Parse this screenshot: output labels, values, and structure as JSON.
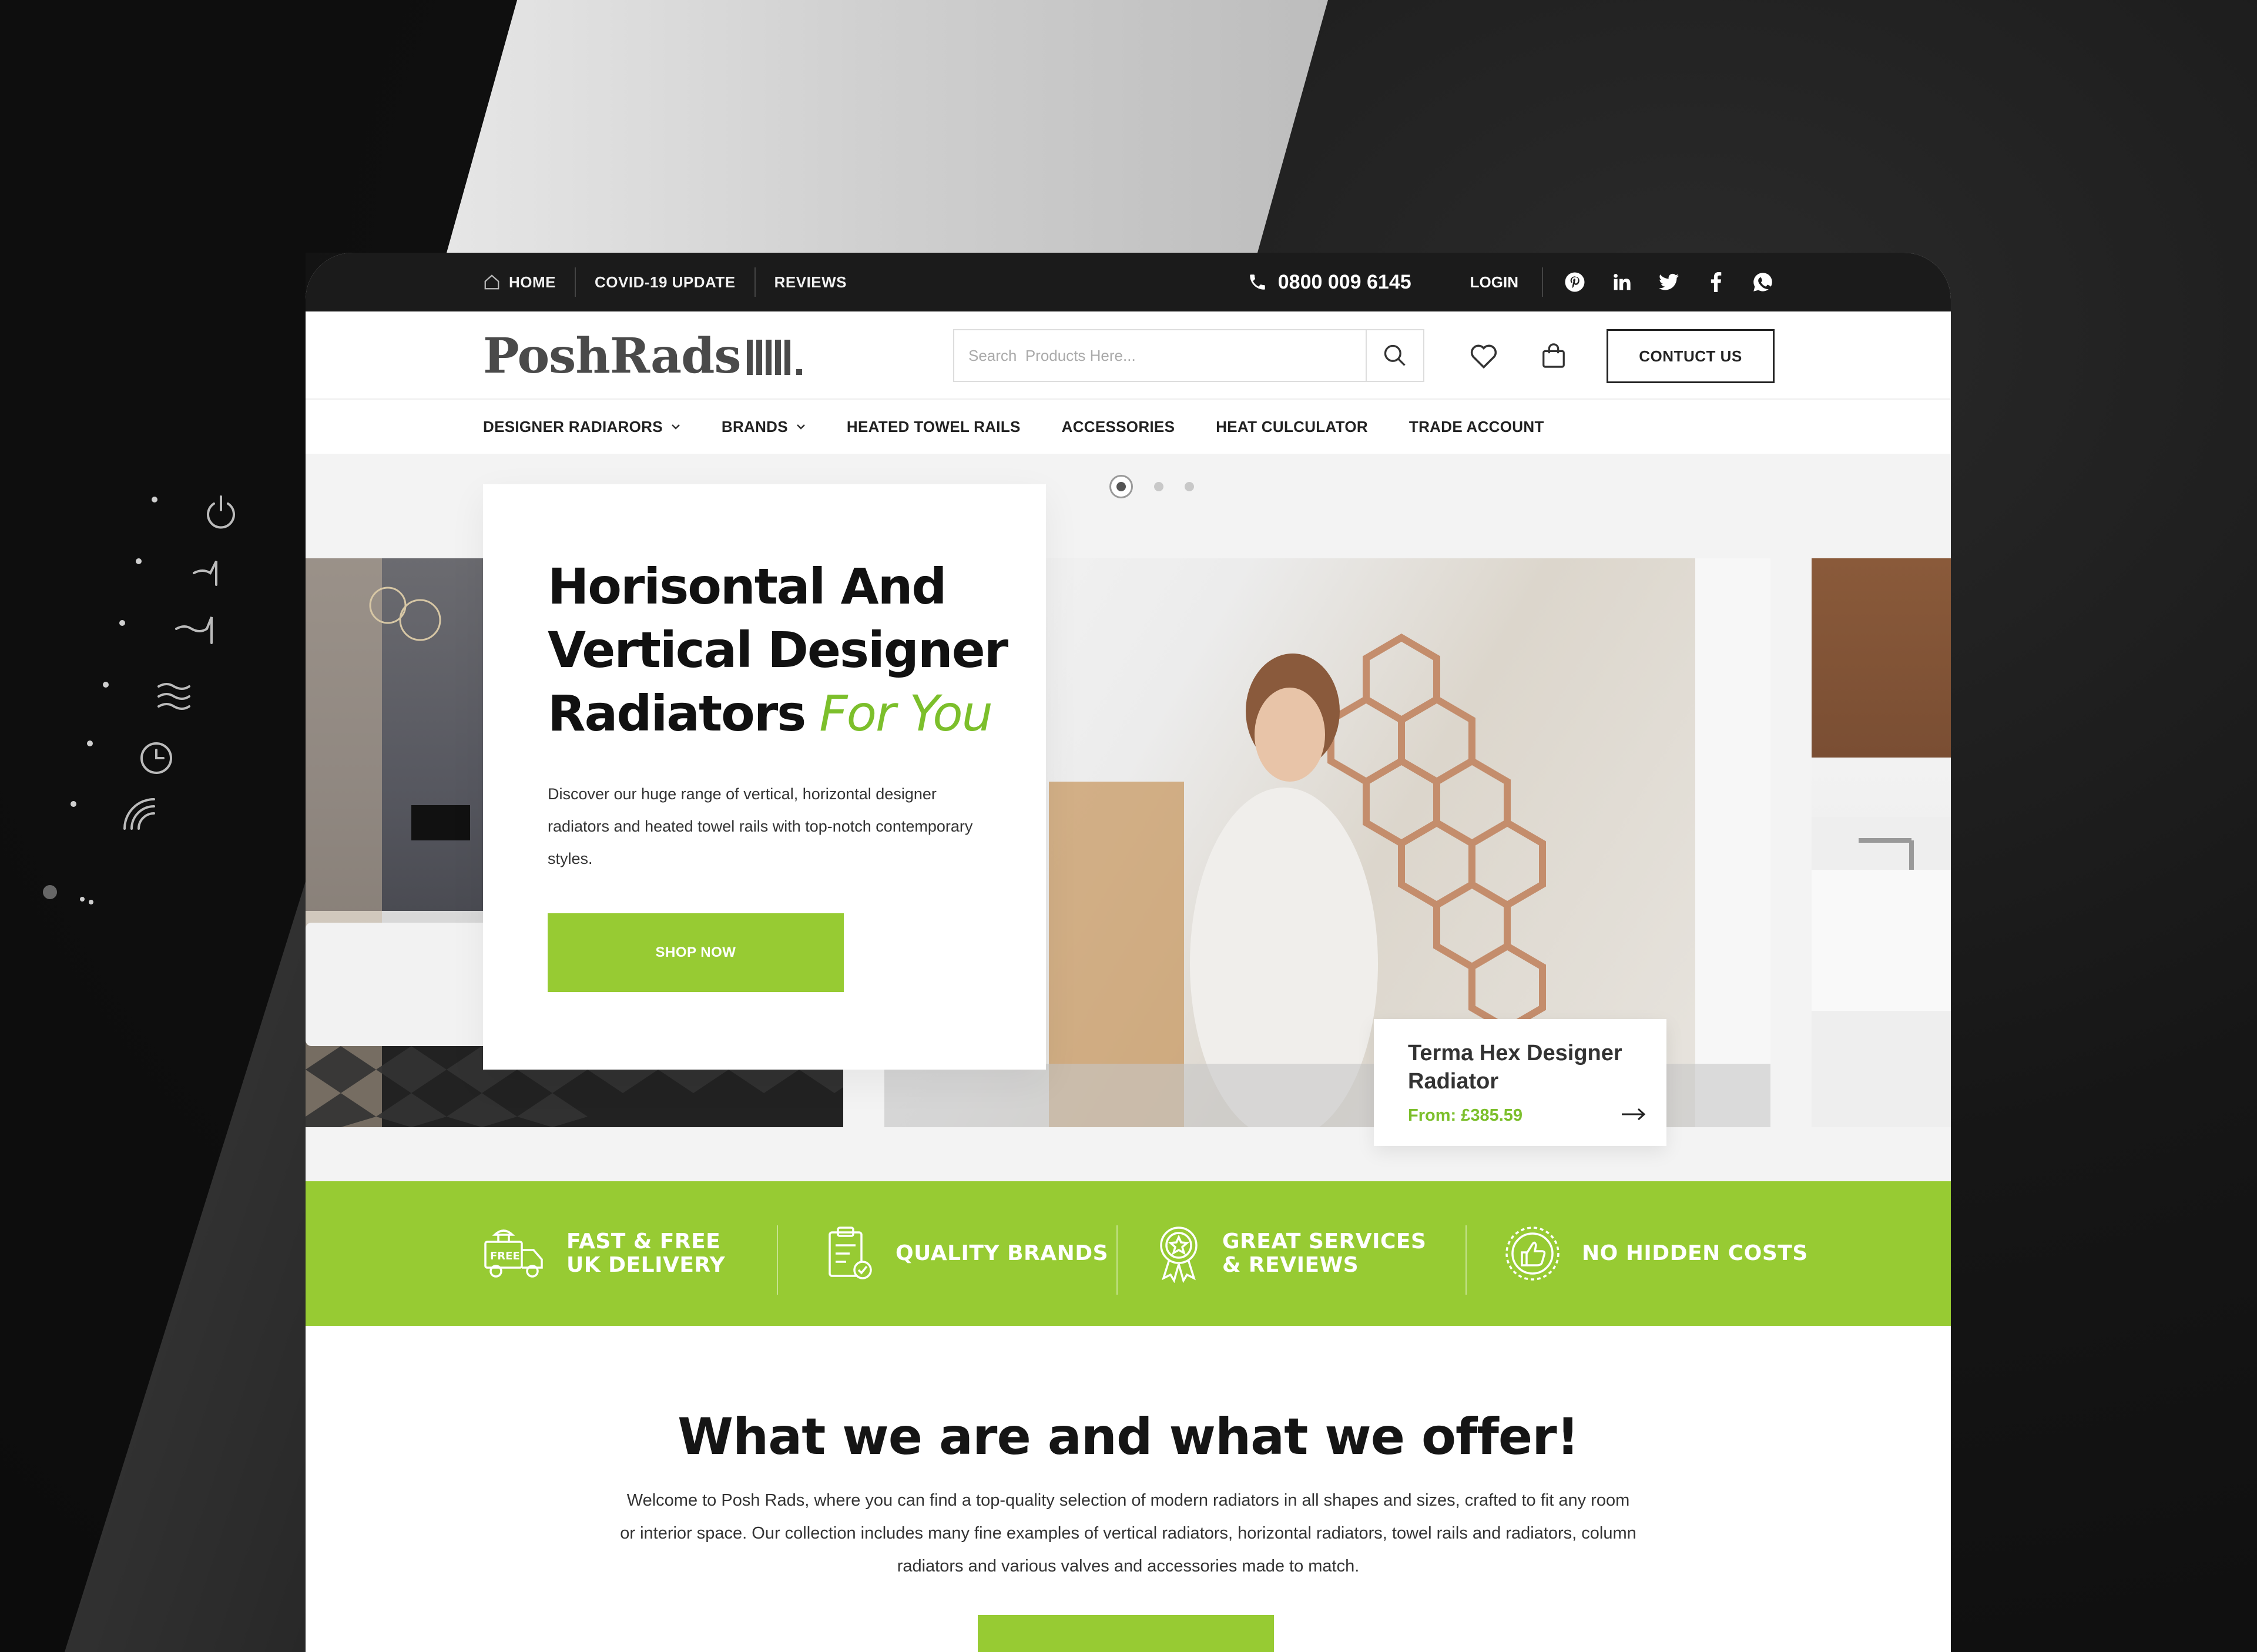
{
  "topbar": {
    "links": [
      {
        "label": "HOME",
        "icon": "home-icon"
      },
      {
        "label": "COVID-19 UPDATE"
      },
      {
        "label": "REVIEWS"
      }
    ],
    "phone": "0800 009 6145",
    "login": "LOGIN",
    "social_icons": [
      "pinterest-icon",
      "linkedin-icon",
      "twitter-icon",
      "facebook-icon",
      "whatsapp-icon"
    ]
  },
  "header": {
    "logo": "PoshRads",
    "search_placeholder": "Search  Products Here...",
    "contact_label": "CONTUCT US"
  },
  "nav": {
    "items": [
      {
        "label": "DESIGNER RADIARORS",
        "dropdown": true
      },
      {
        "label": "BRANDS",
        "dropdown": true
      },
      {
        "label": "HEATED TOWEL RAILS",
        "dropdown": false
      },
      {
        "label": "ACCESSORIES",
        "dropdown": false
      },
      {
        "label": "HEAT CULCULATOR",
        "dropdown": false
      },
      {
        "label": "TRADE ACCOUNT",
        "dropdown": false
      }
    ]
  },
  "hero": {
    "title_line1": "Horisontal And",
    "title_line2": "Vertical Designer",
    "title_line3": "Radiators",
    "title_accent": "For You",
    "description": "Discover our huge range of vertical, horizontal designer radiators and heated towel rails with top-notch contemporary styles.",
    "cta": "SHOP NOW",
    "slide_count": 3,
    "active_slide": 1,
    "product": {
      "name": "Terma Hex Designer Radiator",
      "price": "From: £385.59"
    }
  },
  "features": [
    {
      "label": "FAST & FREE UK DELIVERY",
      "icon": "free-delivery-truck-icon",
      "badge": "FREE"
    },
    {
      "label": "QUALITY BRANDS",
      "icon": "quality-clipboard-icon"
    },
    {
      "label": "GREAT SERVICES & REVIEWS",
      "icon": "award-ribbon-icon"
    },
    {
      "label": "NO HIDDEN COSTS",
      "icon": "thumbs-up-badge-icon"
    }
  ],
  "about": {
    "heading": "What we are and what we offer!",
    "body": "Welcome to Posh Rads, where you can find a top-quality selection of modern radiators in all shapes and sizes, crafted to fit any room or interior space. Our collection includes many fine examples of vertical radiators, horizontal radiators, towel rails and radiators, column radiators and various valves and accessories made to match."
  },
  "colors": {
    "accent_green": "#97cb33",
    "accent_green_text": "#7cbf2b",
    "topbar_bg": "#1b1b1b"
  }
}
